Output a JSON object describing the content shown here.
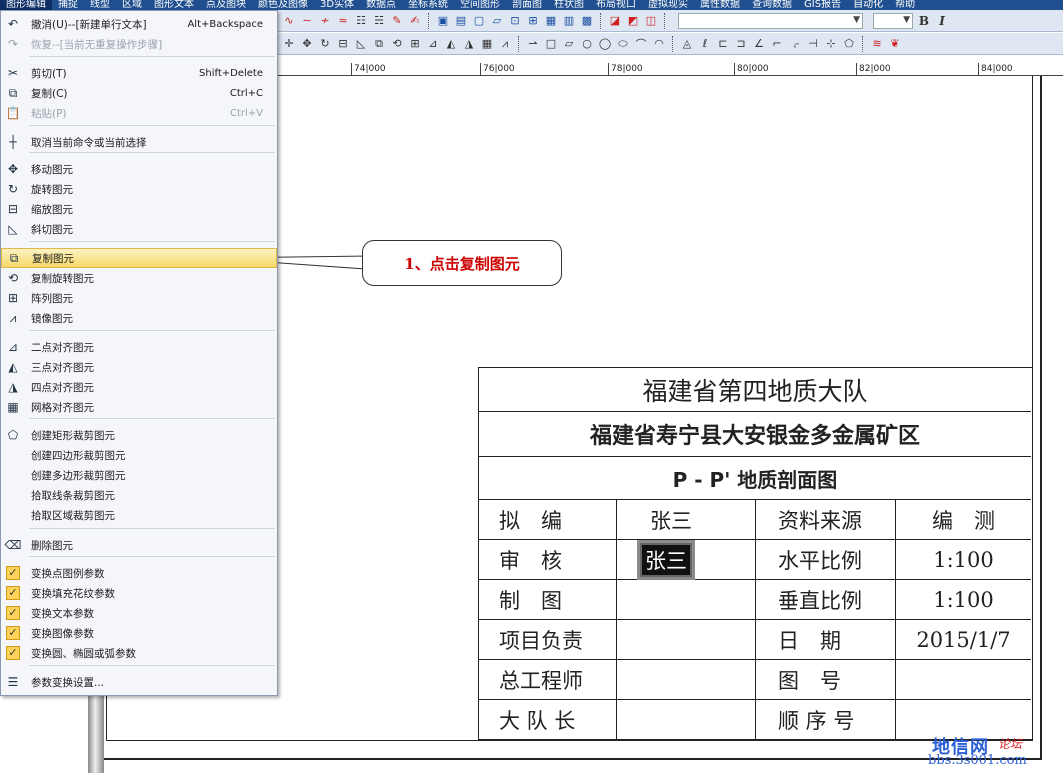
{
  "menubar": [
    "图形编辑",
    "捕捉",
    "线型",
    "区域",
    "图形文本",
    "点及图块",
    "颜色及图像",
    "3D实体",
    "数据点",
    "坐标系统",
    "空间图形",
    "剖面图",
    "柱状图",
    "布局视口",
    "虚拟现实",
    "属性数据",
    "查询数据",
    "GIS报告",
    "自动化",
    "帮助"
  ],
  "toolbar": {
    "bold_label": "B",
    "italic_label": "I"
  },
  "ruler": [
    "74|000",
    "76|000",
    "78|000",
    "80|000",
    "82|000",
    "84|000"
  ],
  "menu": {
    "items": [
      {
        "icon": "undo-icon",
        "label": "撤消(U)--[新建单行文本]",
        "shortcut": "Alt+Backspace"
      },
      {
        "icon": "redo-icon",
        "label": "恢复--[当前无重复操作步骤]",
        "shortcut": ""
      },
      {
        "icon": "cut-icon",
        "label": "剪切(T)",
        "shortcut": "Shift+Delete"
      },
      {
        "icon": "copy-icon",
        "label": "复制(C)",
        "shortcut": "Ctrl+C"
      },
      {
        "icon": "paste-icon",
        "label": "粘贴(P)",
        "shortcut": "Ctrl+V"
      },
      {
        "icon": "crosshair-icon",
        "label": "取消当前命令或当前选择",
        "shortcut": ""
      },
      {
        "icon": "move-icon",
        "label": "移动图元",
        "shortcut": ""
      },
      {
        "icon": "rotate-icon",
        "label": "旋转图元",
        "shortcut": ""
      },
      {
        "icon": "scale-icon",
        "label": "缩放图元",
        "shortcut": ""
      },
      {
        "icon": "shear-icon",
        "label": "斜切图元",
        "shortcut": ""
      },
      {
        "icon": "duplicate-icon",
        "label": "复制图元",
        "shortcut": ""
      },
      {
        "icon": "duplicate-rotate-icon",
        "label": "复制旋转图元",
        "shortcut": ""
      },
      {
        "icon": "array-icon",
        "label": "阵列图元",
        "shortcut": ""
      },
      {
        "icon": "mirror-icon",
        "label": "镜像图元",
        "shortcut": ""
      },
      {
        "icon": "align-2pt-icon",
        "label": "二点对齐图元",
        "shortcut": ""
      },
      {
        "icon": "align-3pt-icon",
        "label": "三点对齐图元",
        "shortcut": ""
      },
      {
        "icon": "align-4pt-icon",
        "label": "四点对齐图元",
        "shortcut": ""
      },
      {
        "icon": "grid-align-icon",
        "label": "网格对齐图元",
        "shortcut": ""
      },
      {
        "icon": "clip-rect-icon",
        "label": "创建矩形裁剪图元",
        "shortcut": ""
      },
      {
        "icon": "",
        "label": "创建四边形裁剪图元",
        "shortcut": ""
      },
      {
        "icon": "",
        "label": "创建多边形裁剪图元",
        "shortcut": ""
      },
      {
        "icon": "",
        "label": "拾取线条裁剪图元",
        "shortcut": ""
      },
      {
        "icon": "",
        "label": "拾取区域裁剪图元",
        "shortcut": ""
      },
      {
        "icon": "eraser-icon",
        "label": "删除图元",
        "shortcut": ""
      },
      {
        "icon": "check-icon",
        "label": "变换点图例参数",
        "shortcut": ""
      },
      {
        "icon": "check-icon",
        "label": "变换填充花纹参数",
        "shortcut": ""
      },
      {
        "icon": "check-icon",
        "label": "变换文本参数",
        "shortcut": ""
      },
      {
        "icon": "check-icon",
        "label": "变换图像参数",
        "shortcut": ""
      },
      {
        "icon": "check-icon",
        "label": "变换圆、椭圆或弧参数",
        "shortcut": ""
      },
      {
        "icon": "settings-icon",
        "label": "参数变换设置...",
        "shortcut": ""
      }
    ]
  },
  "callout": "1、点击复制图元",
  "title_block": {
    "org": "福建省第四地质大队",
    "area": "福建省寿宁县大安银金多金属矿区",
    "drawing": "P - P' 地质剖面图",
    "rows": [
      [
        "拟　编",
        "张三",
        "资料来源",
        "编　测"
      ],
      [
        "审　核",
        "张三",
        "水平比例",
        "1:100"
      ],
      [
        "制　图",
        "",
        "垂直比例",
        "1:100"
      ],
      [
        "项目负责",
        "",
        "日　期",
        "2015/1/7"
      ],
      [
        "总工程师",
        "",
        "图　号",
        ""
      ],
      [
        "大 队 长",
        "",
        "顺 序 号",
        ""
      ]
    ]
  },
  "watermark": {
    "name": "地信网",
    "tag": "论坛",
    "url": "bbs.3s001.com"
  }
}
